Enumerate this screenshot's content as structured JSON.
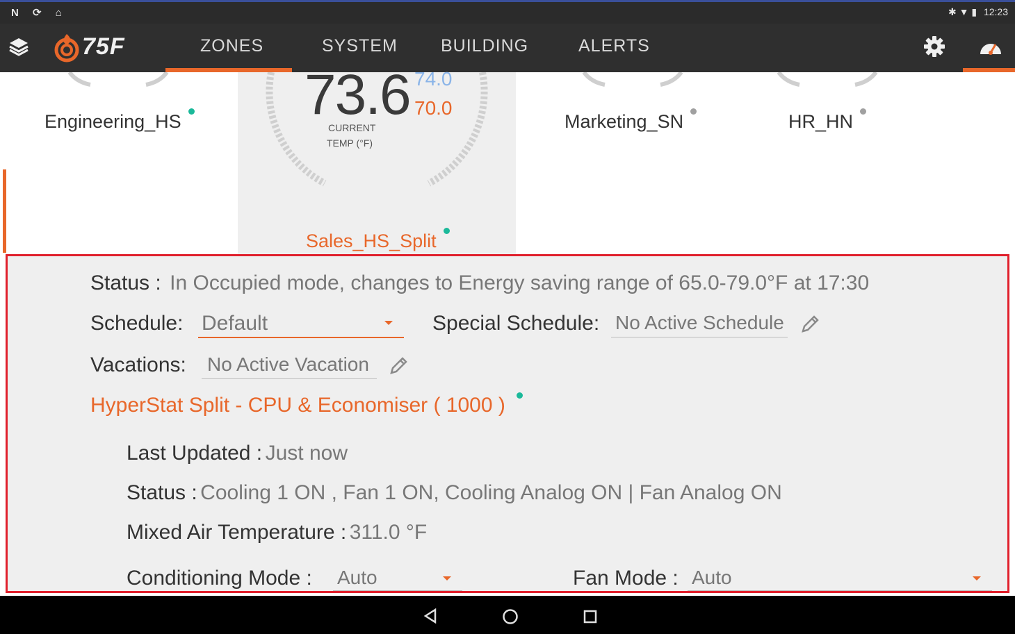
{
  "statusbar": {
    "left_icons": "N ⟳ ⌂",
    "time": "12:23",
    "right_icons": "✱ ▼ ▮"
  },
  "appbar": {
    "brand": "75F",
    "tabs": [
      {
        "label": "ZONES",
        "active": true
      },
      {
        "label": "SYSTEM",
        "active": false
      },
      {
        "label": "BUILDING",
        "active": false
      },
      {
        "label": "ALERTS",
        "active": false
      }
    ]
  },
  "zones": [
    {
      "name": "Engineering_HS",
      "dot_color": "#1bb99a"
    },
    {
      "name": "Sales_HS_Split",
      "dot_color": "#1bb99a",
      "selected": true
    },
    {
      "name": "Marketing_SN",
      "dot_color": "#a0a0a0"
    },
    {
      "name": "HR_HN",
      "dot_color": "#a0a0a0"
    }
  ],
  "gauge": {
    "current": "73.6",
    "cooling_setpoint": "74.0",
    "heating_setpoint": "70.0",
    "label_line1": "CURRENT",
    "label_line2": "TEMP (°F)"
  },
  "detail": {
    "status_label": "Status :",
    "status_value": "In Occupied mode, changes to Energy saving range of 65.0-79.0°F at 17:30",
    "schedule_label": "Schedule:",
    "schedule_value": "Default",
    "special_schedule_label": "Special Schedule:",
    "special_schedule_value": "No Active Schedule",
    "vacations_label": "Vacations:",
    "vacations_value": "No Active Vacation",
    "device_title": "HyperStat Split - CPU & Economiser ( 1000 )",
    "device_dot_color": "#1bb99a",
    "last_updated_label": "Last Updated :",
    "last_updated_value": "Just now",
    "device_status_label": "Status :",
    "device_status_value": "Cooling 1 ON , Fan 1 ON, Cooling Analog ON | Fan Analog ON",
    "mat_label": "Mixed Air Temperature :",
    "mat_value": "311.0 °F",
    "cond_mode_label": "Conditioning Mode :",
    "cond_mode_value": "Auto",
    "fan_mode_label": "Fan Mode :",
    "fan_mode_value": "Auto"
  },
  "colors": {
    "accent": "#e8672a",
    "highlight_border": "#e0202c",
    "online": "#1bb99a",
    "offline": "#a0a0a0"
  }
}
